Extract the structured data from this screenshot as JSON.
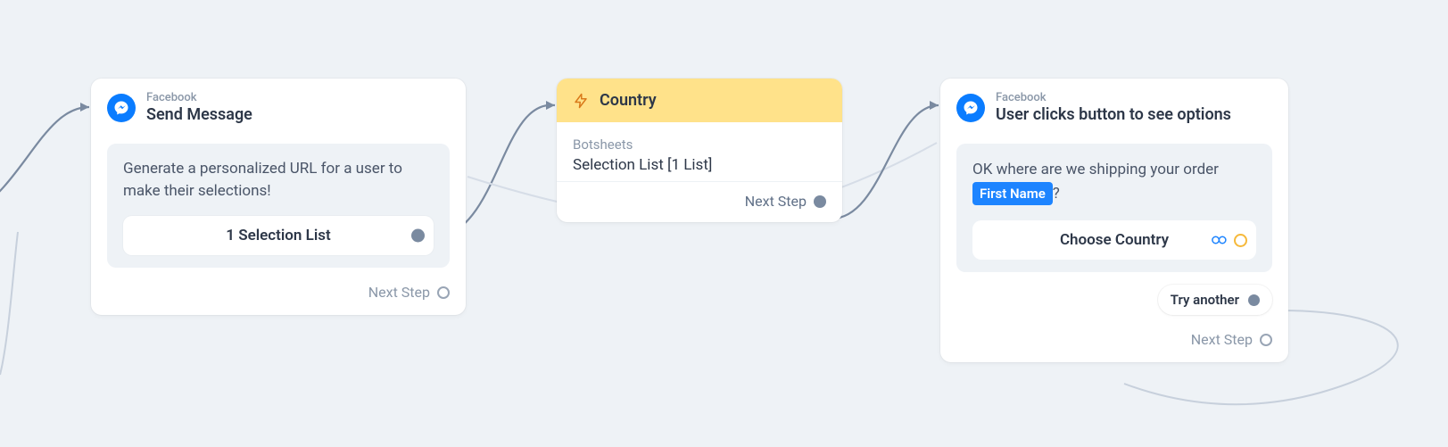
{
  "nodes": {
    "send_message": {
      "eyebrow": "Facebook",
      "title": "Send Message",
      "message": "Generate a personalized URL for a user to make their selections!",
      "list_label": "1 Selection List",
      "next_label": "Next Step"
    },
    "country": {
      "title": "Country",
      "provider": "Botsheets",
      "subtitle": "Selection List [1 List]",
      "next_label": "Next Step"
    },
    "user_clicks": {
      "eyebrow": "Facebook",
      "title": "User clicks button to see options",
      "prompt_text": "OK where are we shipping your order",
      "variable_chip": "First Name",
      "prompt_suffix": "?",
      "cta_label": "Choose Country",
      "try_label": "Try another",
      "next_label": "Next Step"
    }
  }
}
